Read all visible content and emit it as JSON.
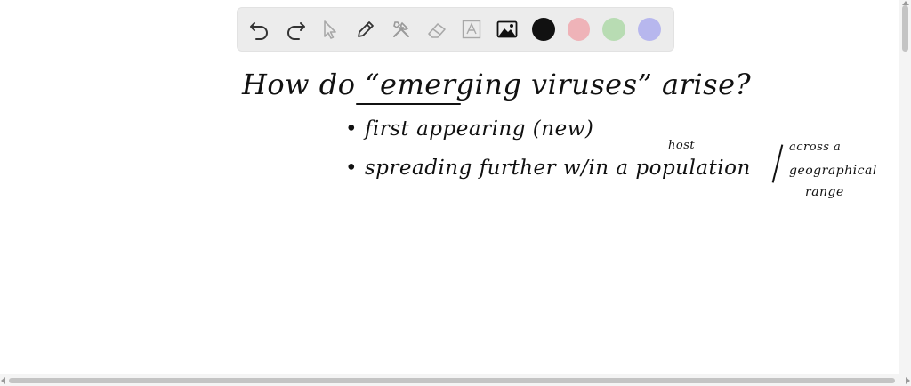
{
  "toolbar": {
    "tools": [
      {
        "name": "undo-icon"
      },
      {
        "name": "redo-icon"
      },
      {
        "name": "select-icon"
      },
      {
        "name": "pen-icon"
      },
      {
        "name": "tools-icon"
      },
      {
        "name": "eraser-icon"
      },
      {
        "name": "text-icon"
      },
      {
        "name": "image-icon"
      }
    ],
    "colors": [
      "#111111",
      "#efb3b8",
      "#b8dcb3",
      "#b7b7ee"
    ]
  },
  "notes": {
    "title": "How do “emerging viruses” arise?",
    "bullet1": "• first appearing (new)",
    "bullet2": "• spreading further w/in a population",
    "host": "host",
    "across": "across a",
    "geographical": "geographical",
    "range": "range"
  }
}
